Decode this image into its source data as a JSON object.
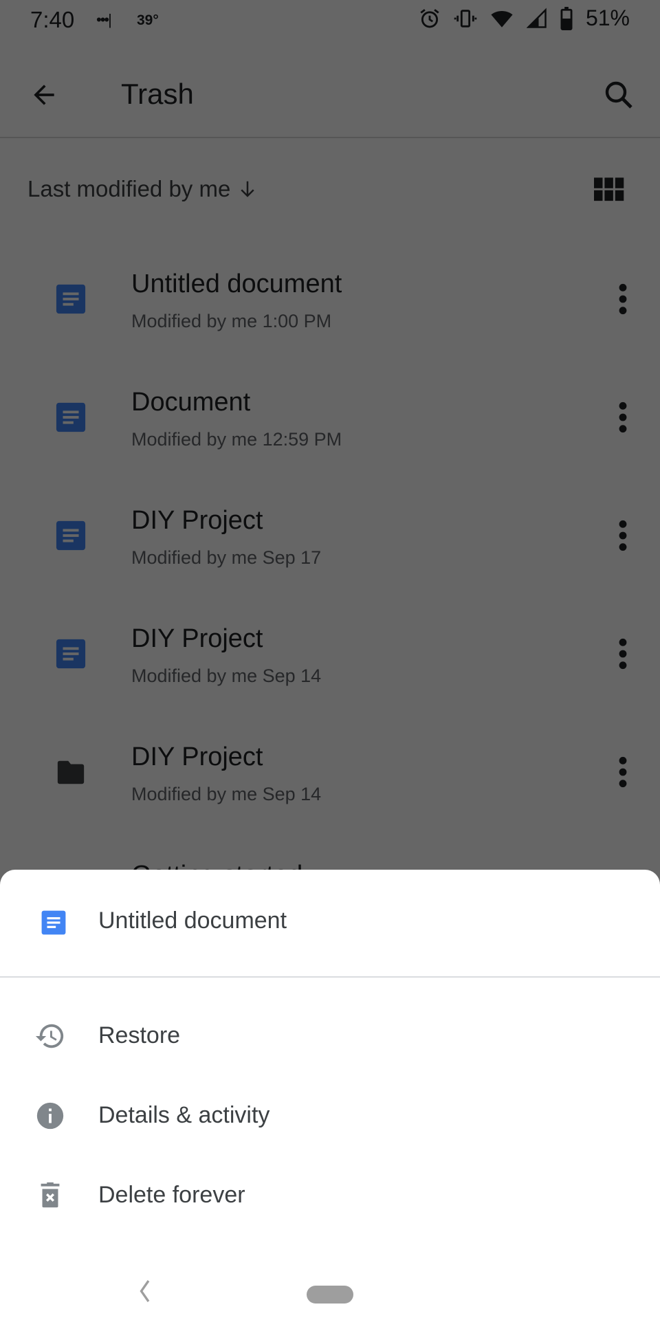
{
  "status_bar": {
    "time": "7:40",
    "indicator_dots": "•••|",
    "temperature": "39°",
    "icons": [
      "alarm-icon",
      "vibrate-icon",
      "wifi-icon",
      "signal-icon",
      "battery-icon"
    ],
    "battery_percent": "51%"
  },
  "app_bar": {
    "back_icon": "arrow-back-icon",
    "title": "Trash",
    "search_icon": "search-icon"
  },
  "sort_bar": {
    "label": "Last modified by me",
    "direction_icon": "arrow-down-icon",
    "view_toggle_icon": "grid-view-icon"
  },
  "files": [
    {
      "name": "Untitled document",
      "meta": "Modified by me 1:00 PM",
      "type": "doc",
      "icon": "docs-icon"
    },
    {
      "name": "Document",
      "meta": "Modified by me 12:59 PM",
      "type": "doc",
      "icon": "docs-icon"
    },
    {
      "name": "DIY Project",
      "meta": "Modified by me Sep 17",
      "type": "doc",
      "icon": "docs-icon"
    },
    {
      "name": "DIY Project",
      "meta": "Modified by me Sep 14",
      "type": "doc",
      "icon": "docs-icon"
    },
    {
      "name": "DIY Project",
      "meta": "Modified by me Sep 14",
      "type": "folder",
      "icon": "folder-icon"
    },
    {
      "name": "Getting started",
      "meta": "",
      "type": "unknown",
      "icon": ""
    }
  ],
  "bottom_sheet": {
    "title": "Untitled document",
    "title_icon": "docs-icon",
    "actions": [
      {
        "label": "Restore",
        "icon": "restore-icon"
      },
      {
        "label": "Details & activity",
        "icon": "info-icon"
      },
      {
        "label": "Delete forever",
        "icon": "delete-forever-icon"
      }
    ]
  },
  "colors": {
    "docs_blue": "#4285f4",
    "icon_gray": "#80868b",
    "text_primary": "#202124",
    "text_secondary": "#5f6368",
    "scrim": "rgba(0,0,0,0.6)"
  }
}
